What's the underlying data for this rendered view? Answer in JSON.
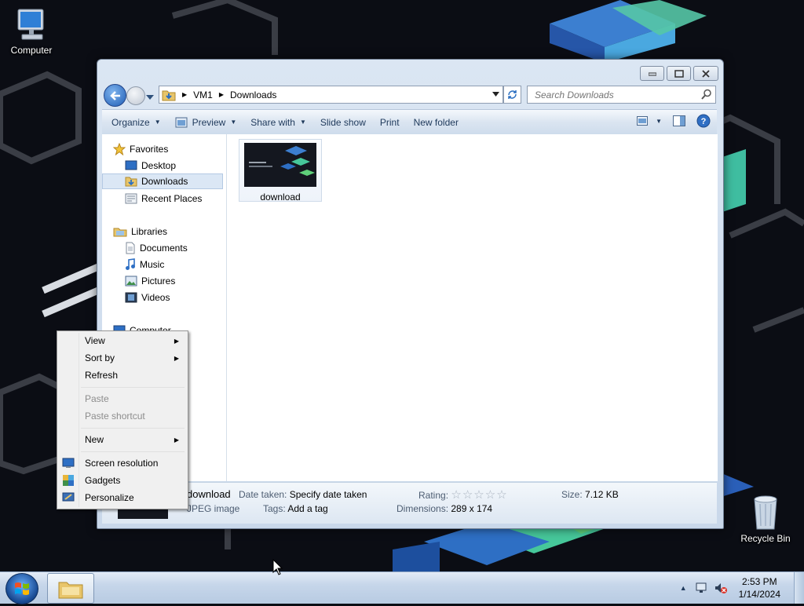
{
  "desktop": {
    "icons": [
      {
        "label": "Computer",
        "icon": "computer-icon"
      },
      {
        "label": "Recycle Bin",
        "icon": "recycle-bin-icon"
      }
    ]
  },
  "explorer": {
    "breadcrumb": [
      "VM1",
      "Downloads"
    ],
    "search_placeholder": "Search Downloads",
    "commands": [
      {
        "label": "Organize",
        "dropdown": true
      },
      {
        "label": "Preview",
        "dropdown": true
      },
      {
        "label": "Share with",
        "dropdown": true
      },
      {
        "label": "Slide show",
        "dropdown": false
      },
      {
        "label": "Print",
        "dropdown": false
      },
      {
        "label": "New folder",
        "dropdown": false
      }
    ],
    "nav": {
      "favorites": "Favorites",
      "desktop": "Desktop",
      "downloads": "Downloads",
      "recent_places": "Recent Places",
      "libraries": "Libraries",
      "documents": "Documents",
      "music": "Music",
      "pictures": "Pictures",
      "videos": "Videos",
      "computer": "Computer"
    },
    "files": [
      {
        "name": "download",
        "type": "jpeg"
      }
    ],
    "details": {
      "name": "download",
      "type": "JPEG image",
      "date_taken_label": "Date taken:",
      "date_taken_value": "Specify date taken",
      "tags_label": "Tags:",
      "tags_value": "Add a tag",
      "rating_label": "Rating:",
      "rating_value": 0,
      "rating_max": 5,
      "dimensions_label": "Dimensions:",
      "dimensions_value": "289 x 174",
      "size_label": "Size:",
      "size_value": "7.12 KB"
    }
  },
  "context_menu": {
    "items": [
      {
        "label": "View",
        "submenu": true,
        "disabled": false
      },
      {
        "label": "Sort by",
        "submenu": true,
        "disabled": false
      },
      {
        "label": "Refresh",
        "submenu": false,
        "disabled": false
      },
      {
        "label": "Paste",
        "submenu": false,
        "disabled": true
      },
      {
        "label": "Paste shortcut",
        "submenu": false,
        "disabled": true
      },
      {
        "label": "New",
        "submenu": true,
        "disabled": false
      },
      {
        "label": "Screen resolution",
        "submenu": false,
        "disabled": false,
        "icon": "screen-resolution-icon"
      },
      {
        "label": "Gadgets",
        "submenu": false,
        "disabled": false,
        "icon": "gadgets-icon"
      },
      {
        "label": "Personalize",
        "submenu": false,
        "disabled": false,
        "icon": "personalize-icon"
      }
    ]
  },
  "taskbar": {
    "time": "2:53 PM",
    "date": "1/14/2024"
  },
  "colors": {
    "accent": "#1f5db5",
    "desktop_bg": "#0b0d14",
    "menu_bg": "#f0f0f0"
  }
}
